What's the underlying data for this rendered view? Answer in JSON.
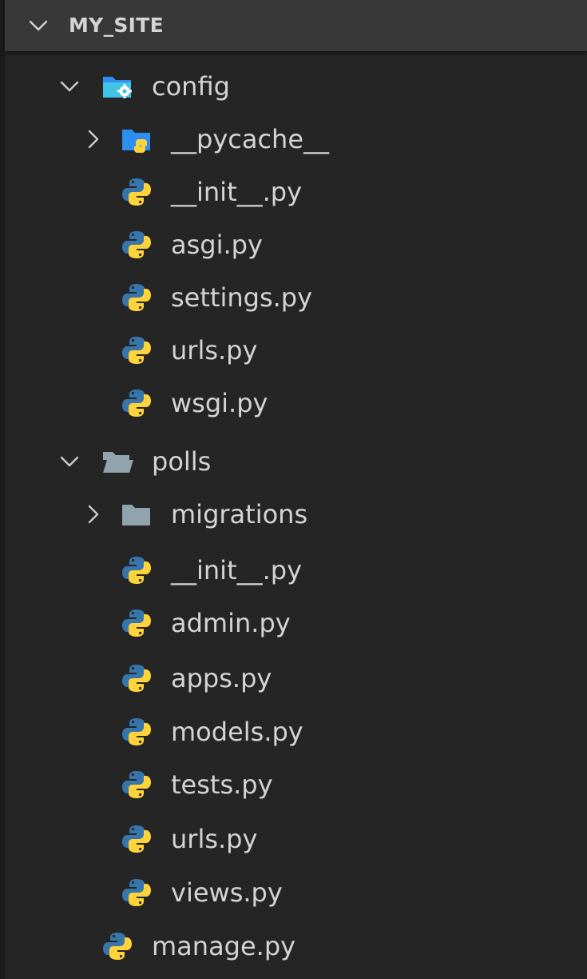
{
  "explorer": {
    "title": "MY_SITE",
    "title_chevron_icon": "chevron-down-icon",
    "items": [
      {
        "label": "config",
        "icon": "folder-config-open-icon",
        "chevron": "chevron-down-icon",
        "depth": 1
      },
      {
        "label": "__pycache__",
        "icon": "folder-python-icon",
        "chevron": "chevron-right-icon",
        "depth": 2
      },
      {
        "label": "__init__.py",
        "icon": "python-file-icon",
        "depth": 2
      },
      {
        "label": "asgi.py",
        "icon": "python-file-icon",
        "depth": 2
      },
      {
        "label": "settings.py",
        "icon": "python-file-icon",
        "depth": 2
      },
      {
        "label": "urls.py",
        "icon": "python-file-icon",
        "depth": 2
      },
      {
        "label": "wsgi.py",
        "icon": "python-file-icon",
        "depth": 2
      },
      {
        "label": "polls",
        "icon": "folder-open-icon",
        "chevron": "chevron-down-icon",
        "depth": 1
      },
      {
        "label": "migrations",
        "icon": "folder-closed-icon",
        "chevron": "chevron-right-icon",
        "depth": 2
      },
      {
        "label": "__init__.py",
        "icon": "python-file-icon",
        "depth": 2
      },
      {
        "label": "admin.py",
        "icon": "python-file-icon",
        "depth": 2
      },
      {
        "label": "apps.py",
        "icon": "python-file-icon",
        "depth": 2
      },
      {
        "label": "models.py",
        "icon": "python-file-icon",
        "depth": 2
      },
      {
        "label": "tests.py",
        "icon": "python-file-icon",
        "depth": 2
      },
      {
        "label": "urls.py",
        "icon": "python-file-icon",
        "depth": 2
      },
      {
        "label": "views.py",
        "icon": "python-file-icon",
        "depth": 2
      },
      {
        "label": "manage.py",
        "icon": "python-file-icon",
        "depth": 1
      }
    ]
  },
  "colors": {
    "background": "#252526",
    "header_background": "#383839",
    "text": "#d4d4d4",
    "python_blue": "#3776ab",
    "python_yellow": "#ffd43b",
    "folder_blue": "#2f8ff0",
    "folder_gray": "#90a4ae",
    "config_teal": "#42c2e5"
  }
}
